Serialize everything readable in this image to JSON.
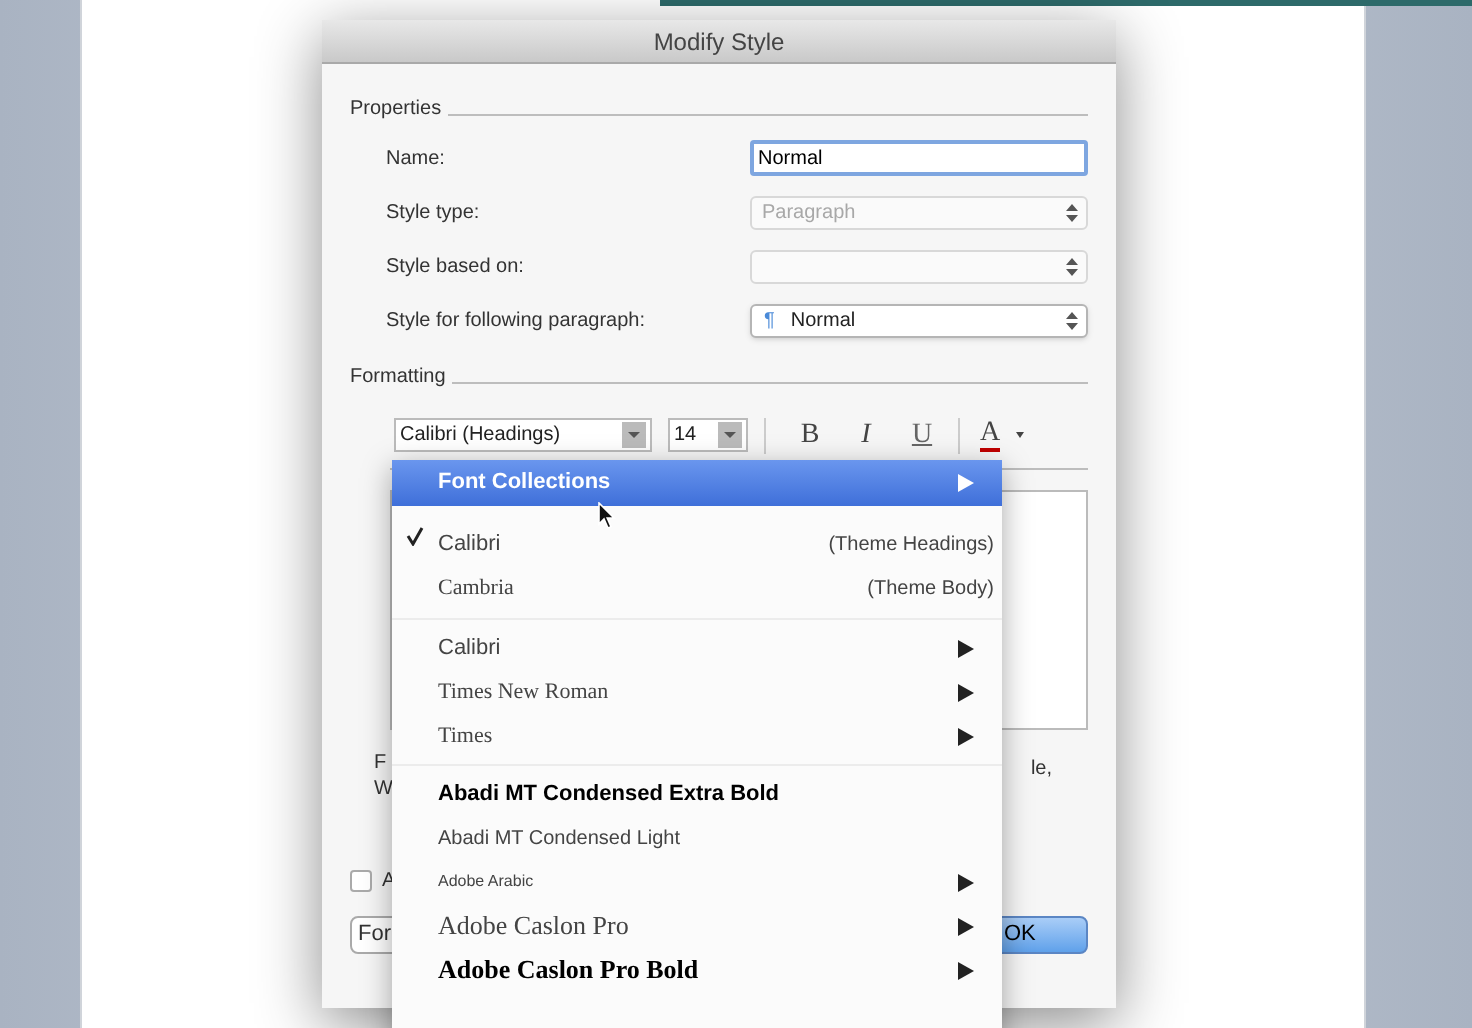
{
  "dialog": {
    "title": "Modify Style"
  },
  "properties": {
    "heading": "Properties",
    "fields": [
      {
        "label": "Name:",
        "kind": "text",
        "value": "Normal",
        "disabled": false
      },
      {
        "label": "Style type:",
        "kind": "select",
        "value": "Paragraph",
        "disabled": true
      },
      {
        "label": "Style based on:",
        "kind": "select",
        "disabled": true
      },
      {
        "label": "Style for following paragraph:",
        "kind": "select",
        "value": "Normal",
        "icon": "¶",
        "disabled": false
      }
    ]
  },
  "formatting": {
    "heading": "Formatting",
    "font": "Calibri (Headings)",
    "size": "14",
    "bold": "B",
    "italic": "I",
    "underline": "U",
    "color_button": "A"
  },
  "description_fragments": [
    "F",
    "W",
    "le,"
  ],
  "checkbox": {
    "label": "A",
    "checked": false
  },
  "buttons": [
    {
      "label": "For",
      "kind": "normal"
    },
    {
      "label": "OK",
      "kind": "default"
    }
  ],
  "font_menu": {
    "sections": [
      {
        "items": [
          {
            "label": "Font Collections",
            "selected": true,
            "checked": false,
            "submenu": true,
            "bold": true
          }
        ]
      },
      {
        "items": [
          {
            "label": "Calibri",
            "note": "(Theme Headings)",
            "selected": false,
            "checked": true,
            "submenu": false,
            "bold": false
          },
          {
            "label": "Cambria",
            "note": "(Theme Body)",
            "selected": false,
            "checked": false,
            "submenu": false,
            "bold": false
          }
        ]
      },
      {
        "items": [
          {
            "label": "Calibri",
            "selected": false,
            "checked": false,
            "submenu": true,
            "bold": false
          },
          {
            "label": "Times New Roman",
            "selected": false,
            "checked": false,
            "submenu": true,
            "bold": false
          },
          {
            "label": "Times",
            "selected": false,
            "checked": false,
            "submenu": true,
            "bold": false
          }
        ]
      },
      {
        "items": [
          {
            "label": "Abadi MT Condensed Extra Bold",
            "selected": false,
            "checked": false,
            "submenu": false,
            "bold": true
          },
          {
            "label": "Abadi MT Condensed Light",
            "selected": false,
            "checked": false,
            "submenu": false,
            "bold": false
          },
          {
            "label": "Adobe Arabic",
            "selected": false,
            "checked": false,
            "submenu": true,
            "bold": false
          },
          {
            "label": "Adobe Caslon Pro",
            "selected": false,
            "checked": false,
            "submenu": true,
            "bold": false
          },
          {
            "label": "Adobe Caslon Pro Bold",
            "selected": false,
            "checked": false,
            "submenu": true,
            "bold": true
          }
        ]
      }
    ]
  }
}
